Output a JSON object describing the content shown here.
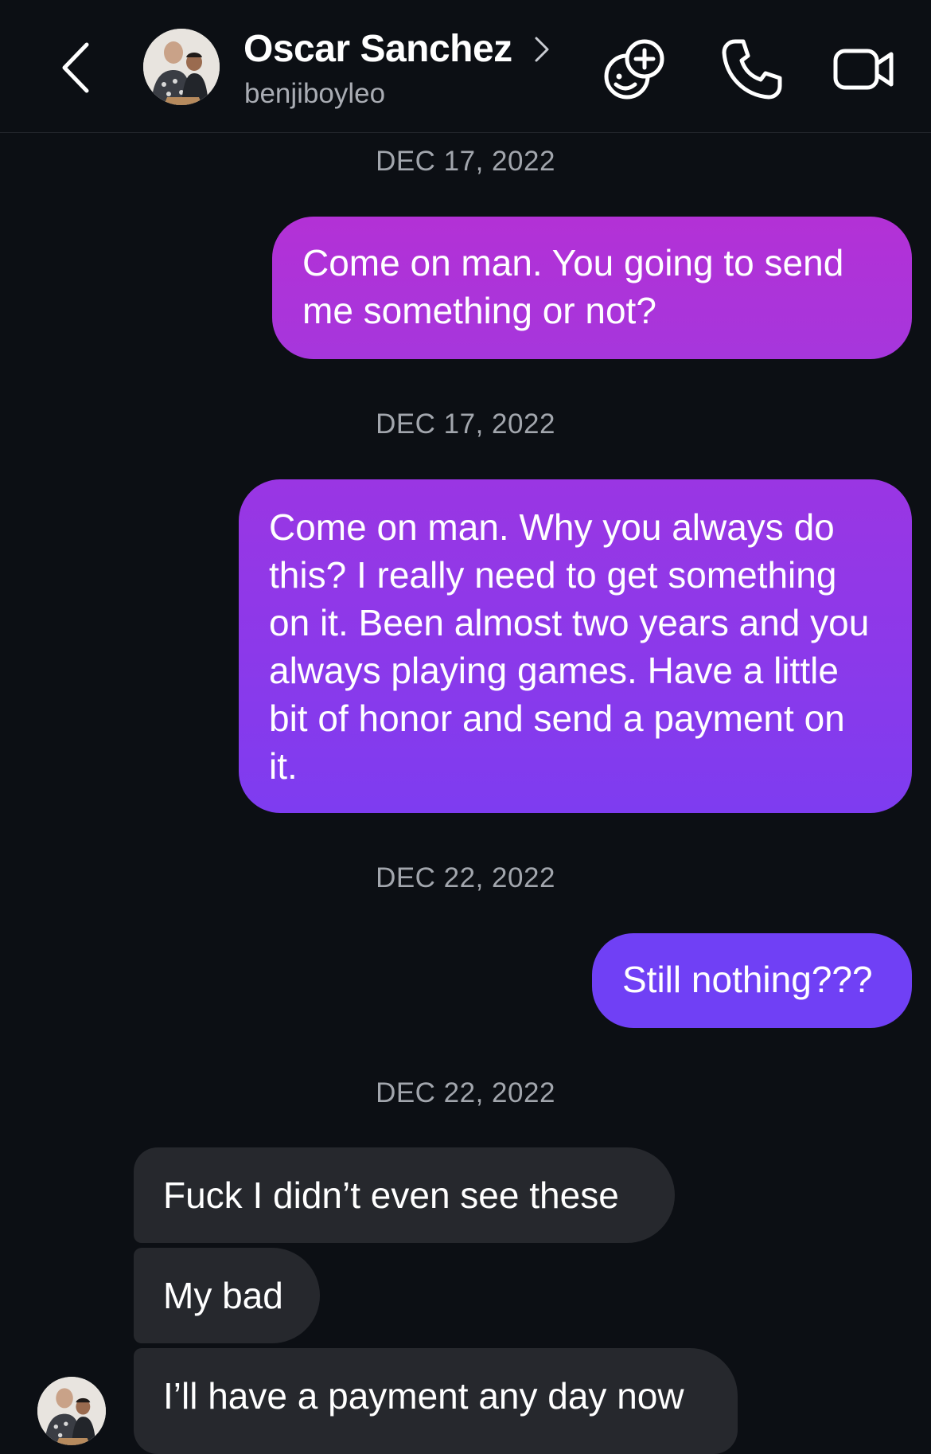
{
  "header": {
    "contact_name": "Oscar Sanchez",
    "username": "benjiboyleo",
    "icons": {
      "back": "chevron-left-icon",
      "profile_chevron": "chevron-right-icon",
      "effects": "effects-add-icon",
      "call": "phone-icon",
      "video": "video-camera-icon"
    }
  },
  "thread": [
    {
      "type": "date",
      "text": "DEC 17, 2022"
    },
    {
      "type": "sent",
      "text": "Come on man. You going to send me something or not?"
    },
    {
      "type": "date",
      "text": "DEC 17, 2022"
    },
    {
      "type": "sent",
      "text": "Come on man. Why you always do this? I really need to get something on it. Been almost two years and you always playing games. Have a little bit of honor and send a payment on it."
    },
    {
      "type": "date",
      "text": "DEC 22, 2022"
    },
    {
      "type": "sent",
      "text": "Still nothing???"
    },
    {
      "type": "date",
      "text": "DEC 22, 2022"
    },
    {
      "type": "received",
      "text": "Fuck I didn’t even see these"
    },
    {
      "type": "received",
      "text": "My bad"
    },
    {
      "type": "received",
      "text": "I’ll have a payment any day now"
    }
  ],
  "colors": {
    "background": "#0c0f14",
    "sent_gradient_top": "#b331d6",
    "sent_gradient_mid": "#9a36e3",
    "sent_gradient_bottom": "#7040f5",
    "received": "#26282d",
    "date_text": "#a2a6ad",
    "username_text": "#a9acb3"
  }
}
